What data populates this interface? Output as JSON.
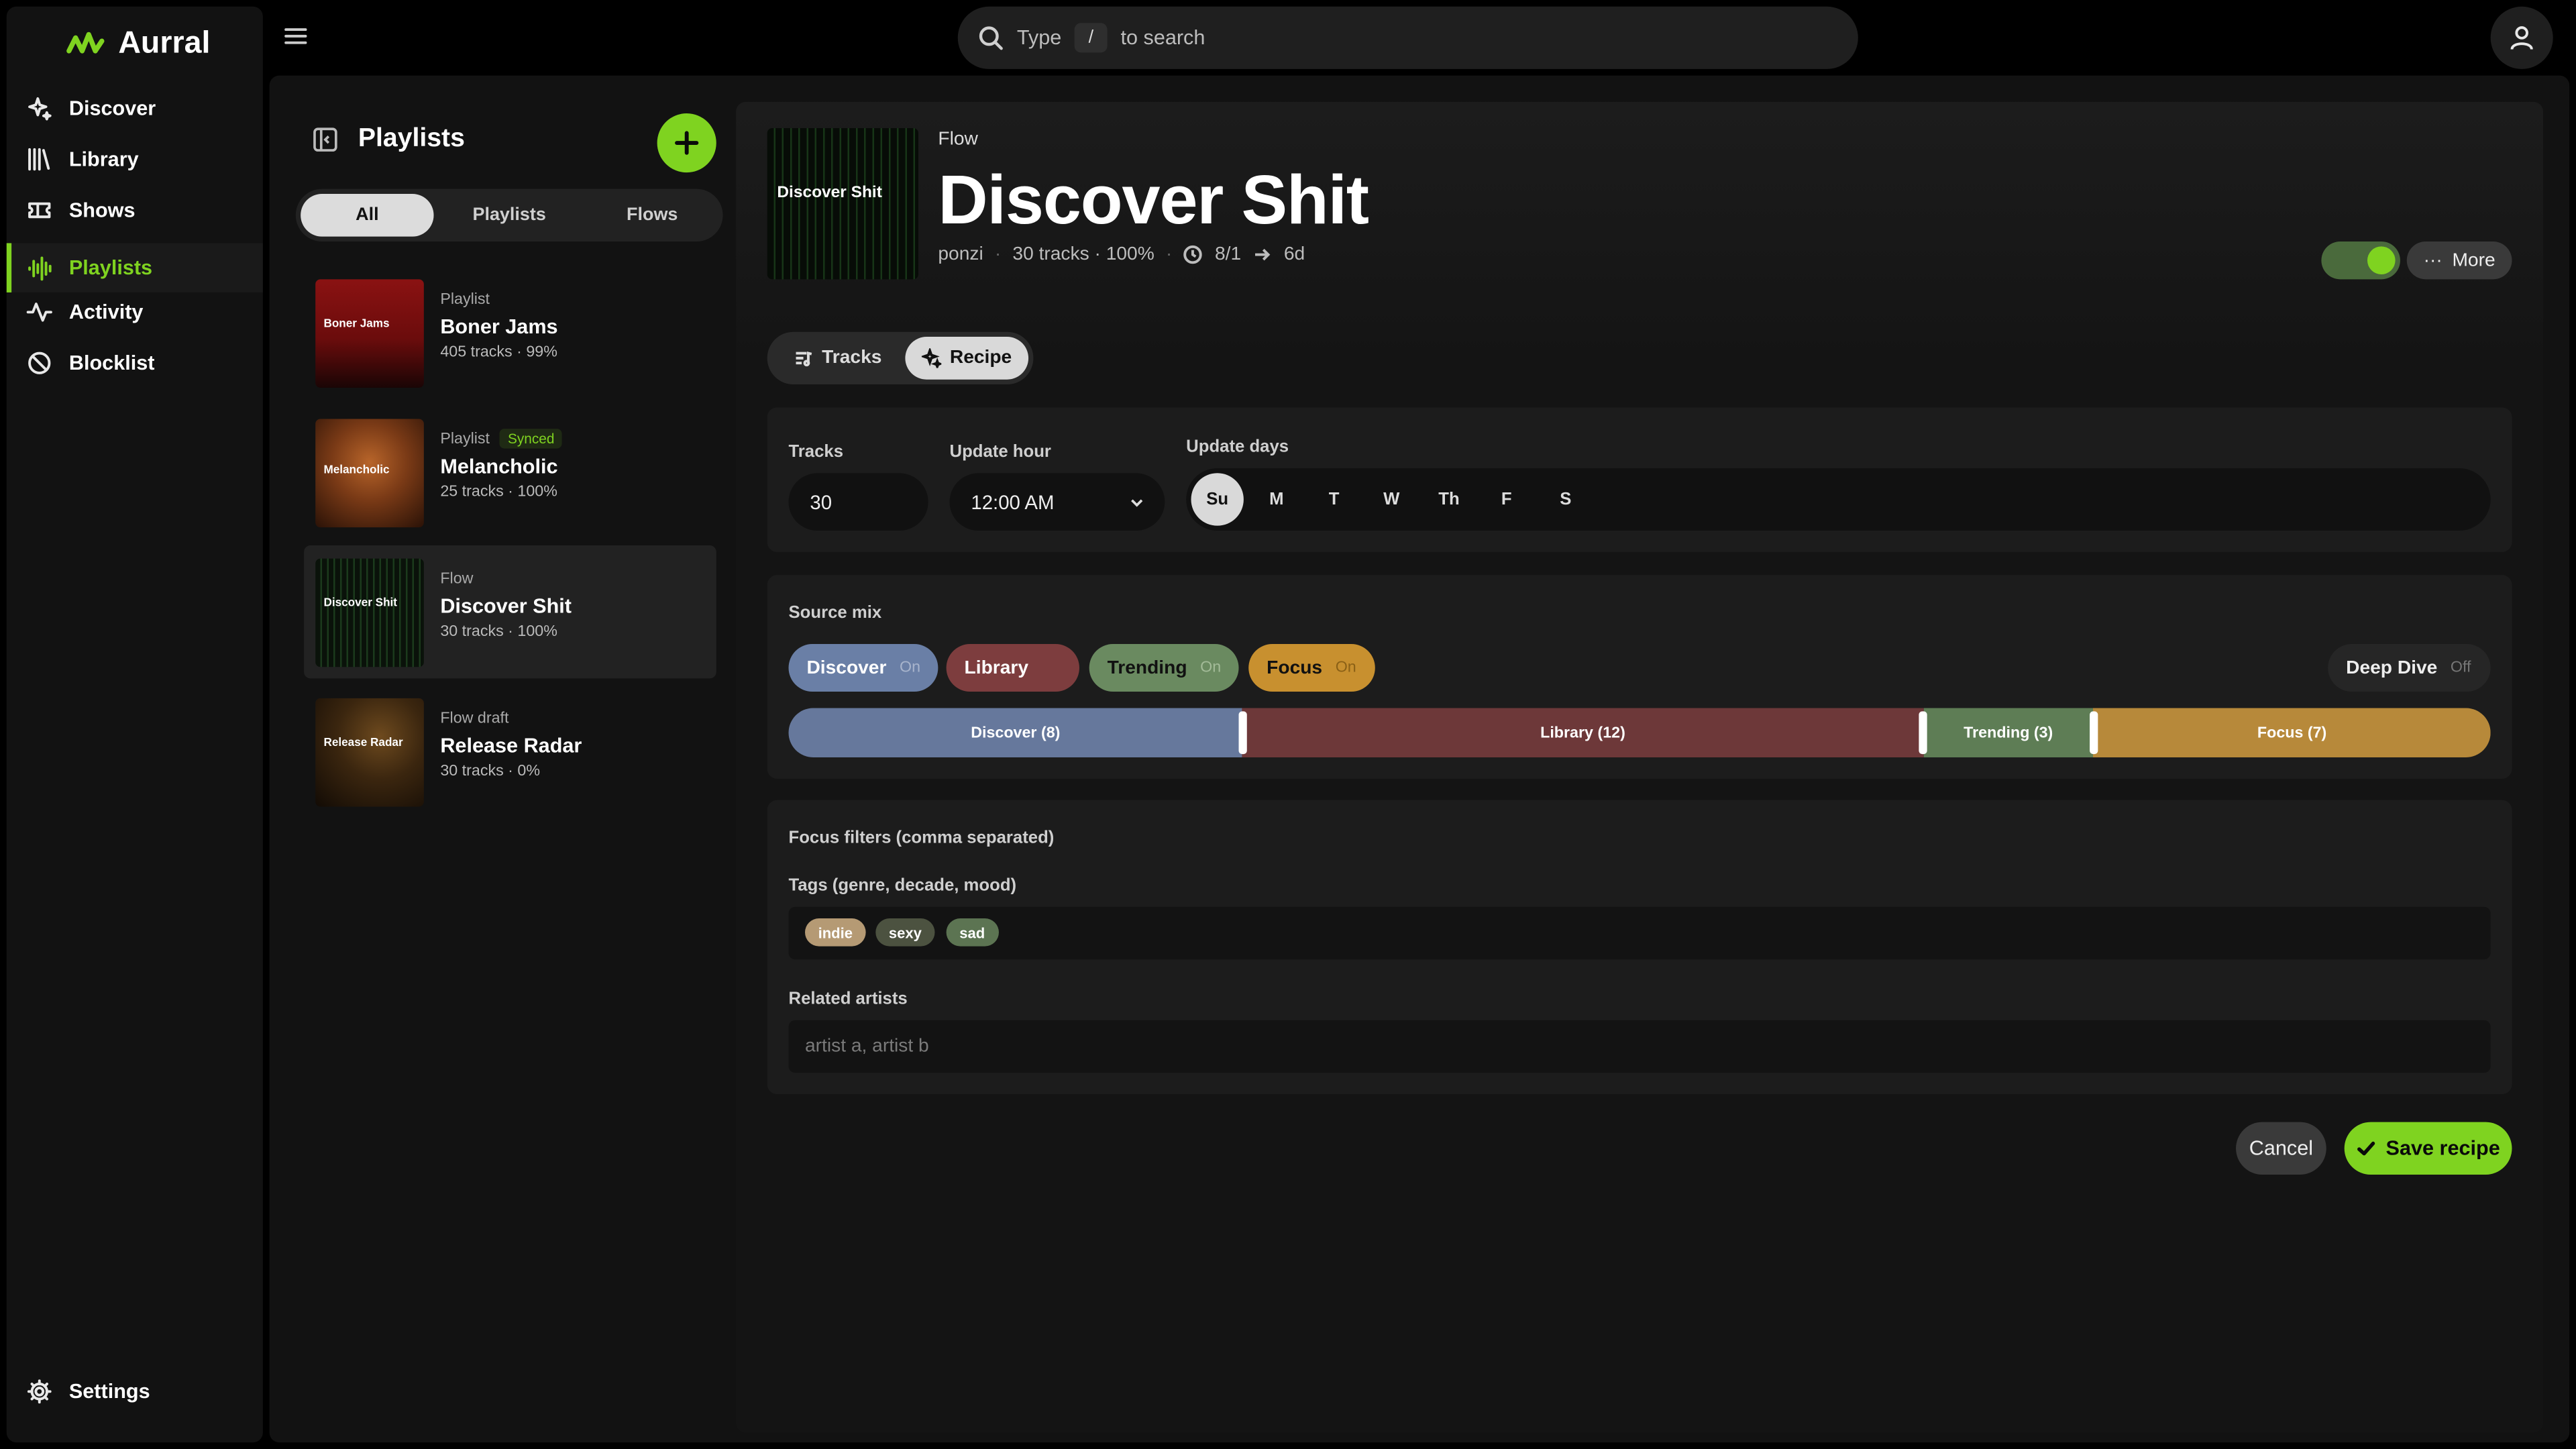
{
  "app": {
    "brand": "Aurral",
    "accent": "#7fd320"
  },
  "nav": {
    "items": [
      {
        "label": "Discover",
        "icon": "sparkles-icon"
      },
      {
        "label": "Library",
        "icon": "library-icon"
      },
      {
        "label": "Shows",
        "icon": "ticket-icon"
      },
      {
        "label": "Playlists",
        "icon": "audio-waveform-icon",
        "active": true
      },
      {
        "label": "Activity",
        "icon": "activity-icon"
      },
      {
        "label": "Blocklist",
        "icon": "ban-icon"
      }
    ],
    "settings": "Settings"
  },
  "search": {
    "prefix": "Type",
    "key": "/",
    "suffix": "to search"
  },
  "playlists": {
    "title": "Playlists",
    "filters": [
      "All",
      "Playlists",
      "Flows"
    ],
    "active_filter": "All",
    "items": [
      {
        "type": "Playlist",
        "name": "Boner Jams",
        "sub": "405 tracks · 99%",
        "thumb_text": "Boner Jams",
        "badge": ""
      },
      {
        "type": "Playlist",
        "name": "Melancholic",
        "sub": "25 tracks · 100%",
        "thumb_text": "Melancholic",
        "badge": "Synced"
      },
      {
        "type": "Flow",
        "name": "Discover Shit",
        "sub": "30 tracks · 100%",
        "thumb_text": "Discover Shit",
        "badge": "",
        "selected": true
      },
      {
        "type": "Flow draft",
        "name": "Release Radar",
        "sub": "30 tracks · 0%",
        "thumb_text": "Release Radar",
        "badge": ""
      }
    ]
  },
  "detail": {
    "type": "Flow",
    "title": "Discover Shit",
    "cover_text": "Discover Shit",
    "owner": "ponzi",
    "stats": "30 tracks · 100%",
    "date_from": "8/1",
    "date_to": "6d",
    "enabled": true,
    "more_label": "More",
    "tabs": [
      "Tracks",
      "Recipe"
    ],
    "active_tab": "Recipe"
  },
  "recipe": {
    "tracks_label": "Tracks",
    "tracks_value": "30",
    "hour_label": "Update hour",
    "hour_value": "12:00 AM",
    "days_label": "Update days",
    "days": [
      "Su",
      "M",
      "T",
      "W",
      "Th",
      "F",
      "S"
    ],
    "active_days": [
      "Su"
    ],
    "source_mix_label": "Source mix",
    "sources": [
      {
        "name": "Discover",
        "state": "On",
        "color": "#6a7fa6"
      },
      {
        "name": "Library",
        "state": "",
        "color": "#7d3d3e"
      },
      {
        "name": "Trending",
        "state": "On",
        "color": "#6a8a60"
      },
      {
        "name": "Focus",
        "state": "On",
        "color": "#c8902f"
      }
    ],
    "deep_dive": {
      "name": "Deep Dive",
      "state": "Off"
    },
    "mix": [
      {
        "label": "Discover (8)",
        "count": 8,
        "color": "#66789c"
      },
      {
        "label": "Library (12)",
        "count": 12,
        "color": "#6d3839"
      },
      {
        "label": "Trending (3)",
        "count": 3,
        "color": "#5e7d55"
      },
      {
        "label": "Focus (7)",
        "count": 7,
        "color": "#b7893a"
      }
    ],
    "focus_label": "Focus filters (comma separated)",
    "tags_label": "Tags (genre, decade, mood)",
    "tags": [
      {
        "text": "indie",
        "color": "#b59a74"
      },
      {
        "text": "sexy",
        "color": "#4c5240"
      },
      {
        "text": "sad",
        "color": "#5c7452"
      }
    ],
    "artists_label": "Related artists",
    "artists_placeholder": "artist a, artist b",
    "cancel_label": "Cancel",
    "save_label": "Save recipe"
  }
}
